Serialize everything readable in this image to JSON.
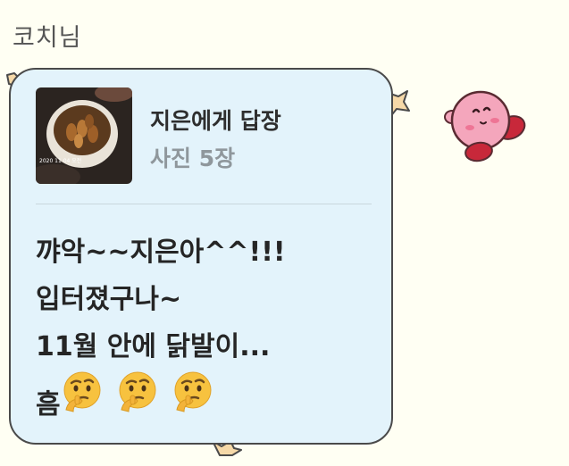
{
  "chat": {
    "sender_name": "코치님",
    "message": {
      "reply_preview": {
        "title": "지은에게 답장",
        "subtitle": "사진 5장",
        "thumbnail_caption": "2020 11 04 오전"
      },
      "text_lines": [
        "꺄악~~지은아^^!!!",
        "입터졌구나~",
        "11월 안에 닭발이..."
      ],
      "last_line_text": "흠",
      "emojis": [
        "thinking-face",
        "thinking-face",
        "thinking-face"
      ]
    }
  },
  "colors": {
    "background": "#fffff3",
    "bubble_fill": "#e3f3fb",
    "bubble_border": "#4a4a4a",
    "reply_subtitle": "#8f979c",
    "kirby_pink": "#f4a6bc",
    "kirby_shoes": "#c8283a",
    "emoji_yellow": "#f7c23f"
  },
  "decorations": [
    "kirby-sticker",
    "star-decoration"
  ]
}
